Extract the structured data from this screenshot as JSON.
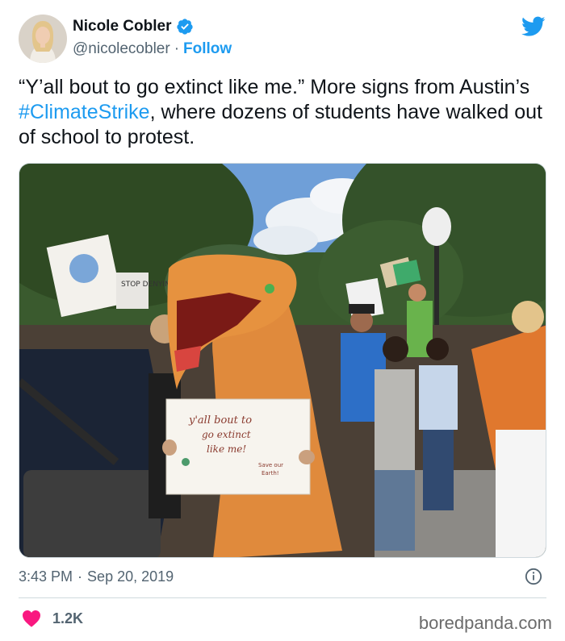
{
  "user": {
    "name": "Nicole Cobler",
    "handle": "@nicolecobler",
    "separator": "·",
    "follow_label": "Follow"
  },
  "tweet": {
    "text_before": "“Y’all bout to go extinct like me.” More signs from Austin’s ",
    "hashtag": "#ClimateStrike",
    "text_after": ", where dozens of students have walked out of school to protest."
  },
  "media": {
    "sign_text_line1": "y'all bout to",
    "sign_text_line2": "go extinct",
    "sign_text_line3": "like me!",
    "sign_small_line1": "Save our",
    "sign_small_line2": "Earth!",
    "bg_sign_text": "STOP DENYING OUR"
  },
  "footer": {
    "time": "3:43 PM",
    "separator": "·",
    "date": "Sep 20, 2019",
    "like_count": "1.2K"
  },
  "watermark": "boredpanda.com",
  "colors": {
    "accent": "#1d9bf0",
    "heart": "#f91880",
    "text": "#0f1419",
    "muted": "#536471"
  },
  "icons": [
    "verified-badge-icon",
    "twitter-bird-icon",
    "info-icon",
    "heart-icon"
  ]
}
